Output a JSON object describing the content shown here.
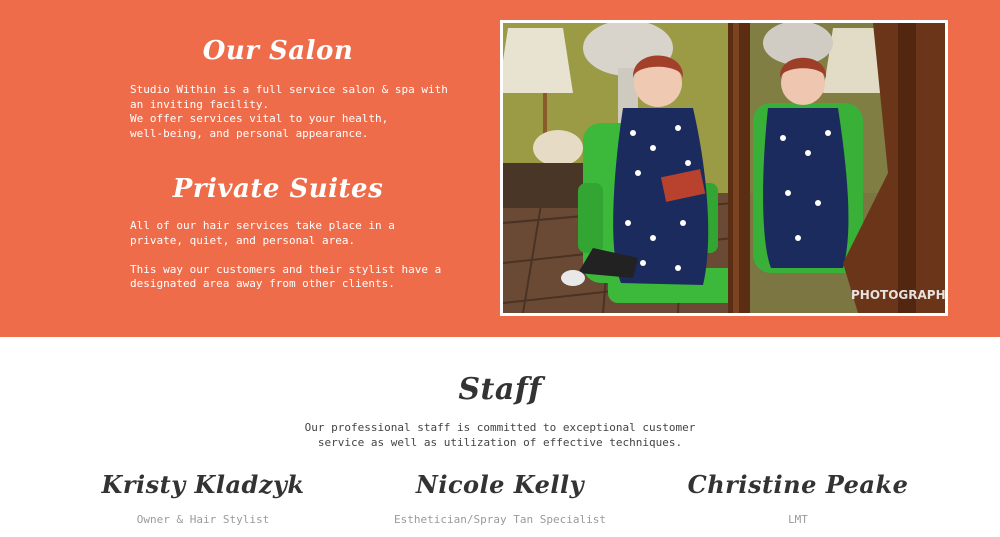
{
  "salon": {
    "title": "Our Salon",
    "text": "Studio Within is a full service salon & spa with\nan inviting facility.\nWe offer services vital to your health,\nwell-being, and personal appearance."
  },
  "suites": {
    "title": "Private Suites",
    "text": "All of our hair services take place in a\nprivate, quiet, and personal area.\n\nThis way our customers and their stylist have a\ndesignated area away from other clients."
  },
  "photo": {
    "watermark": "PHOTOGRAPHY"
  },
  "staff": {
    "title": "Staff",
    "description": "Our professional staff is committed to exceptional customer\nservice as well as utilization of effective techniques.",
    "members": [
      {
        "name": "Kristy Kladzyk",
        "role": "Owner & Hair Stylist"
      },
      {
        "name": "Nicole Kelly",
        "role": "Esthetician/Spray Tan Specialist"
      },
      {
        "name": "Christine Peake",
        "role": "LMT"
      }
    ]
  },
  "colors": {
    "accent": "#ef6c4b",
    "background": "#ffffff",
    "heading": "#333333",
    "muted": "#9a9a9a"
  }
}
